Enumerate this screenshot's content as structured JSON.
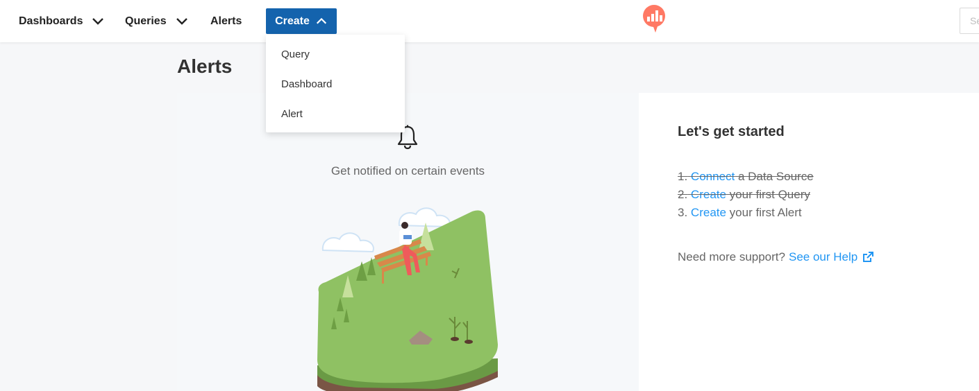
{
  "nav": {
    "dashboards_label": "Dashboards",
    "queries_label": "Queries",
    "alerts_label": "Alerts",
    "create_label": "Create",
    "search_placeholder": "Se"
  },
  "create_menu": {
    "items": [
      {
        "label": "Query"
      },
      {
        "label": "Dashboard"
      },
      {
        "label": "Alert"
      }
    ]
  },
  "page": {
    "title": "Alerts"
  },
  "empty_state": {
    "icon": "bell-icon",
    "message": "Get notified on certain events"
  },
  "getting_started": {
    "title": "Let's get started",
    "steps": [
      {
        "number": "1.",
        "link": "Connect",
        "text": " a Data Source",
        "done": true
      },
      {
        "number": "2.",
        "link": "Create",
        "text": " your first Query",
        "done": true
      },
      {
        "number": "3.",
        "link": "Create",
        "text": " your first Alert",
        "done": false
      }
    ],
    "support_text": "Need more support?",
    "help_link": "See our Help"
  },
  "colors": {
    "primary": "#1463ad",
    "link": "#2196f3",
    "logo": "#ff7964",
    "grass": "#8fc163",
    "soil": "#7a5545"
  }
}
